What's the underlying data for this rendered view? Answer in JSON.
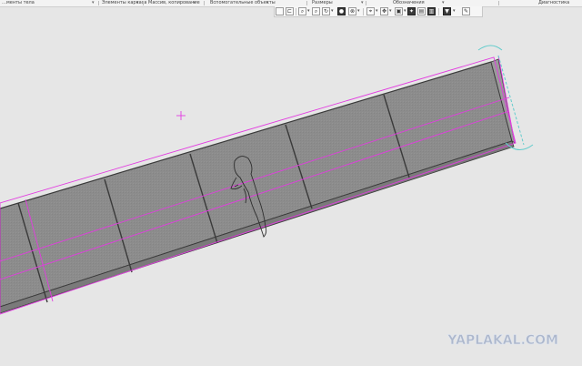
{
  "toolbar_groups": [
    {
      "label": "…менты тела"
    },
    {
      "label": "Элементы каркаса"
    },
    {
      "label": "Массив, копирование"
    },
    {
      "label": "Вспомогательные объекты"
    },
    {
      "label": "Размеры"
    },
    {
      "label": "Обозначения"
    },
    {
      "label": "Диагностика"
    }
  ],
  "toolbar_icons": [
    "blank-page-icon",
    "new-sketch-icon",
    "zoom-icon",
    "zoom-all-icon",
    "rotate-icon",
    "pan-icon",
    "view-orientation-icon",
    "display-mode-icon",
    "perspective-icon",
    "section-icon",
    "filter-icon",
    "selection-icon",
    "sketch-mode-icon",
    "edit-mode-icon",
    "filter-active-icon",
    "pencil-icon"
  ],
  "colors": {
    "background": "#e6e6e6",
    "part_fill": "#8c8c8c",
    "selection_outline": "#e23ce0",
    "edge_dark": "#3a3a3a",
    "axis_cyan": "#62cccc"
  },
  "watermark": {
    "text": "YAPLAKAL.COM"
  }
}
